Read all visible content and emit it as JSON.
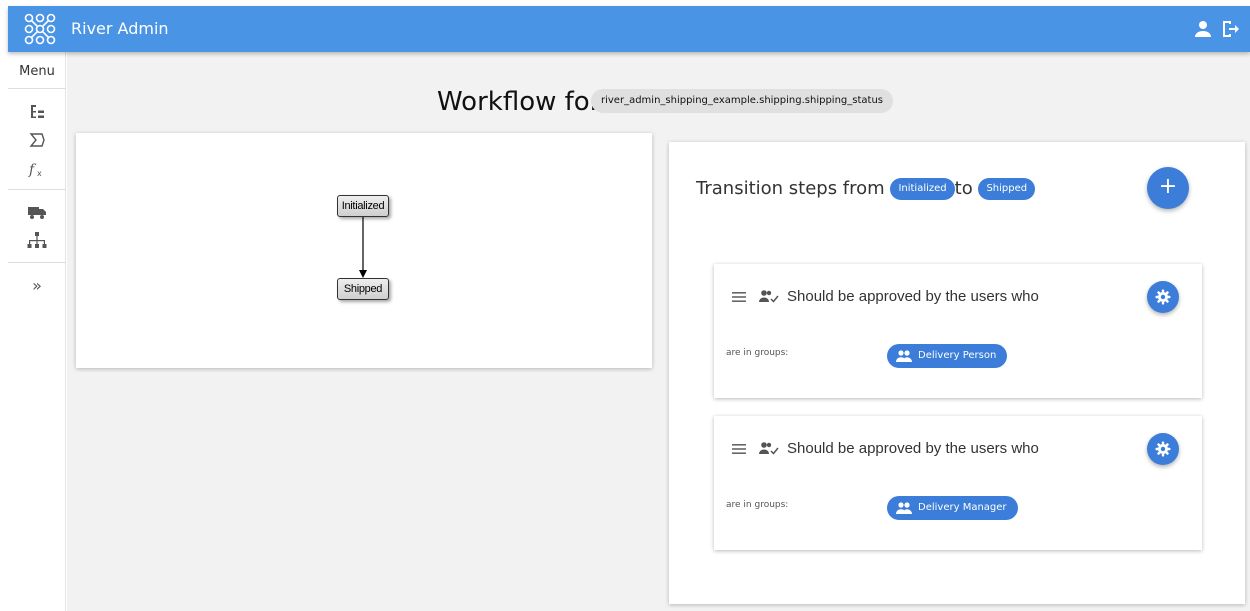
{
  "header": {
    "title": "River Admin",
    "logo_icon": "river-logo-icon",
    "user_icon": "person-icon",
    "logout_icon": "logout-icon",
    "color": "#4a94e6"
  },
  "sidebar": {
    "menu_label": "Menu",
    "items": [
      {
        "icon": "tree-list-icon"
      },
      {
        "icon": "sigma-icon"
      },
      {
        "icon": "function-icon"
      },
      {
        "icon": "truck-icon"
      },
      {
        "icon": "sitemap-icon"
      },
      {
        "icon": "expand-chevron-icon",
        "label": "»"
      }
    ]
  },
  "main": {
    "title": "Workflow for",
    "model": "river_admin_shipping_example.shipping.shipping_status"
  },
  "diagram": {
    "states": [
      "Initialized",
      "Shipped"
    ]
  },
  "transition": {
    "heading_prefix": "Transition steps from",
    "from_state": "Initialized",
    "connector": "to",
    "to_state": "Shipped",
    "add_label": "+",
    "accent": "#3b7dd8",
    "steps": [
      {
        "text": "Should be approved by the users who",
        "groups_label": "are in groups:",
        "group": "Delivery Person"
      },
      {
        "text": "Should be approved by the users who",
        "groups_label": "are in groups:",
        "group": "Delivery Manager"
      }
    ]
  }
}
